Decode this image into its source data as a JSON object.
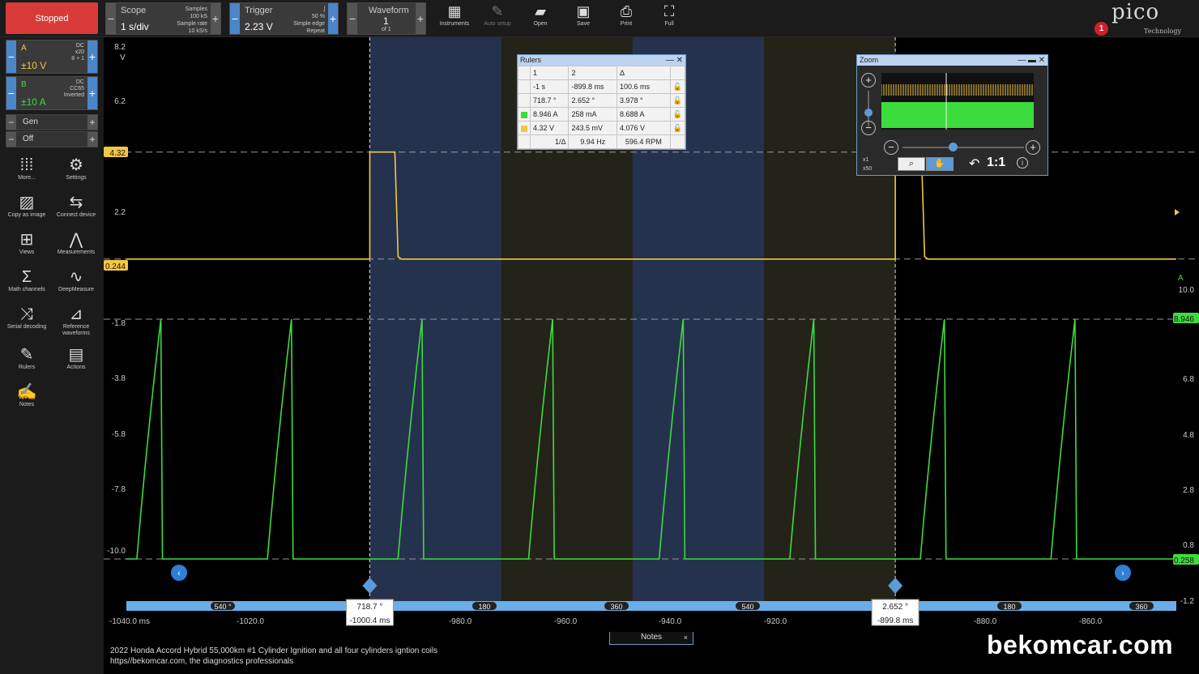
{
  "toolbar": {
    "status_label": "Stopped",
    "scope": {
      "label": "Scope",
      "value": "1 s/div",
      "samples_label": "Samples",
      "samples": "100 kS",
      "rate_label": "Sample rate",
      "rate": "10 kS/s"
    },
    "trigger": {
      "label": "Trigger",
      "value": "2.23 V",
      "percent": "50 %",
      "mode": "Simple edge",
      "repeat": "Repeat"
    },
    "waveform": {
      "label": "Waveform",
      "value": "1",
      "of": "of 1"
    },
    "tools": [
      "Instruments",
      "Auto setup",
      "Open",
      "Save",
      "Print",
      "Full"
    ],
    "logo": "pico",
    "logo_sub": "Technology",
    "alert_count": "1"
  },
  "channels": [
    {
      "name": "A",
      "range": "±10 V",
      "info1": "DC",
      "info2": "x20",
      "info3": "8 + 1",
      "color": "#f2c744"
    },
    {
      "name": "B",
      "range": "±10 A",
      "info1": "DC",
      "info2": "CC65",
      "info3": "Inverted",
      "color": "#3ddc3d"
    }
  ],
  "generator": {
    "gen_label": "Gen",
    "off_label": "Off"
  },
  "side_tools": [
    "More...",
    "Settings",
    "Copy as image",
    "Connect device",
    "Views",
    "Measurements",
    "Math channels",
    "DeepMeasure",
    "Serial decoding",
    "Reference waveforms",
    "Rulers",
    "Actions",
    "Notes"
  ],
  "axis": {
    "left_ticks": [
      "8.2",
      "6.2",
      "4.32",
      "2.2",
      "0.244",
      "-1.8",
      "-3.8",
      "-5.8",
      "-7.8",
      "-10.0"
    ],
    "left_unit": "V",
    "right_ticks": [
      "10.0",
      "8.946",
      "6.8",
      "4.8",
      "2.8",
      "0.8",
      "0.258",
      "-1.2"
    ],
    "right_unit": "A",
    "time_ticks": [
      "-1040.0 ms",
      "-1020.0",
      "-1000.4 ms",
      "-980.0",
      "-960.0",
      "-940.0",
      "-920.0",
      "-899.8 ms",
      "-880.0",
      "-860.0"
    ],
    "angle_ticks": [
      "540 °",
      "718.7 °",
      "180",
      "360",
      "540",
      "2.652 °",
      "180",
      "360"
    ]
  },
  "rulers": {
    "title": "Rulers",
    "header": [
      "1",
      "2",
      "Δ"
    ],
    "rows": [
      [
        "-1 s",
        "-899.8 ms",
        "100.6 ms"
      ],
      [
        "718.7 °",
        "2.652 °",
        "3.978 °"
      ],
      [
        "8.946 A",
        "258 mA",
        "8.688 A"
      ],
      [
        "4.32 V",
        "243.5 mV",
        "4.076 V"
      ]
    ],
    "freq_label": "1/Δ",
    "freq": "9.94 Hz",
    "rpm": "596.4 RPM"
  },
  "zoom": {
    "title": "Zoom",
    "x1": "x1",
    "x50": "x50",
    "ratio": "1:1"
  },
  "notes": {
    "tab_label": "Notes",
    "line1": "2022 Honda Accord Hybrid 55,000km #1 Cylinder Ignition and all four cylinders igntion coils",
    "line2": "https//bekomcar.com, the diagnostics professionals"
  },
  "watermark": "bekomcar.com",
  "chart_data": {
    "type": "line",
    "xlabel": "",
    "ylabel": "",
    "series": [
      {
        "name": "A",
        "unit": "V",
        "ylim": [
          -12.0,
          8.2
        ],
        "baseline": 0.244,
        "pulse_top": 4.32,
        "pulses_ms": [
          [
            -1000.4,
            -995.6
          ],
          [
            -899.8,
            -894.8
          ]
        ]
      },
      {
        "name": "B",
        "unit": "A",
        "ylim": [
          -2.3,
          12.0
        ],
        "baseline": 0.258,
        "peak": 8.946,
        "ramp_start_ms": [
          -1045.0,
          -1020.0,
          -995.0,
          -970.0,
          -945.0,
          -920.0,
          -895.0,
          -870.0,
          -845.0
        ],
        "ramp_end_ms": [
          -1040.4,
          -1015.4,
          -990.4,
          -965.4,
          -940.4,
          -915.4,
          -890.4,
          -865.4,
          -840.4
        ]
      }
    ],
    "x_range_ms": [
      -1047.0,
      -846.0
    ],
    "rulers_ms": [
      -1000.4,
      -899.8
    ]
  }
}
